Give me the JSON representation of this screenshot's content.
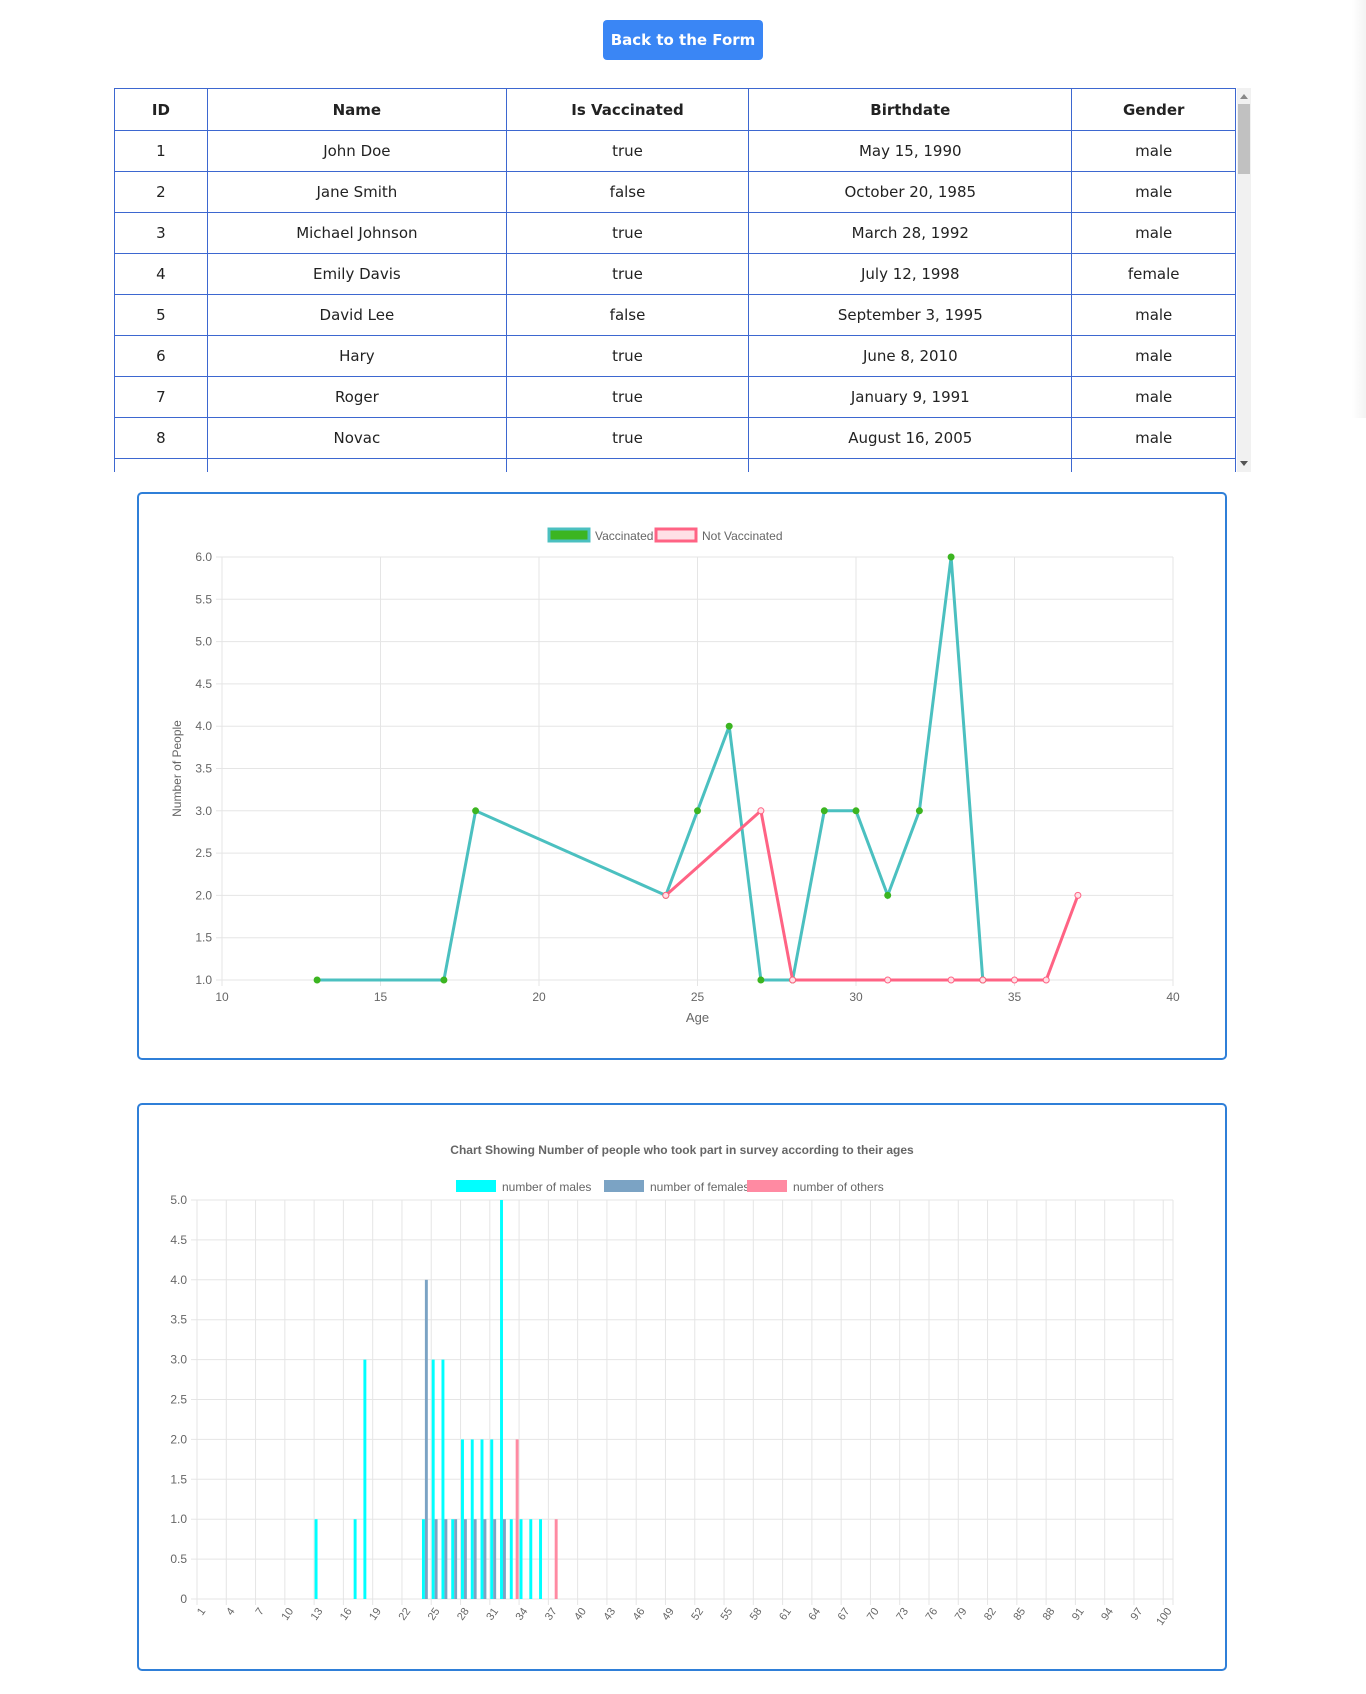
{
  "back_button": {
    "label": "Back to the Form"
  },
  "table": {
    "columns": [
      "ID",
      "Name",
      "Is Vaccinated",
      "Birthdate",
      "Gender"
    ],
    "rows": [
      [
        "1",
        "John Doe",
        "true",
        "May 15, 1990",
        "male"
      ],
      [
        "2",
        "Jane Smith",
        "false",
        "October 20, 1985",
        "male"
      ],
      [
        "3",
        "Michael Johnson",
        "true",
        "March 28, 1992",
        "male"
      ],
      [
        "4",
        "Emily Davis",
        "true",
        "July 12, 1998",
        "female"
      ],
      [
        "5",
        "David Lee",
        "false",
        "September 3, 1995",
        "male"
      ],
      [
        "6",
        "Hary",
        "true",
        "June 8, 2010",
        "male"
      ],
      [
        "7",
        "Roger",
        "true",
        "January 9, 1991",
        "male"
      ],
      [
        "8",
        "Novac",
        "true",
        "August 16, 2005",
        "male"
      ],
      [
        "",
        "",
        "",
        "",
        ""
      ]
    ]
  },
  "chart_data": [
    {
      "type": "line",
      "title": "",
      "xlabel": "Age",
      "ylabel": "Number of People",
      "xlim": [
        10,
        40
      ],
      "ylim": [
        1,
        6
      ],
      "x_ticks": [
        "10",
        "15",
        "20",
        "25",
        "30",
        "35",
        "40"
      ],
      "y_ticks": [
        "1.0",
        "1.5",
        "2.0",
        "2.5",
        "3.0",
        "3.5",
        "4.0",
        "4.5",
        "5.0",
        "5.5",
        "6.0"
      ],
      "grid": true,
      "legend": "top-center",
      "series": [
        {
          "name": "Vaccinated",
          "color": "#4bc0c0",
          "point_color": "#3cb521",
          "legend_fill": "#3cb521",
          "points": [
            [
              13,
              1
            ],
            [
              17,
              1
            ],
            [
              18,
              3
            ],
            [
              24,
              2
            ],
            [
              25,
              3
            ],
            [
              26,
              4
            ],
            [
              27,
              1
            ],
            [
              28,
              1
            ],
            [
              29,
              3
            ],
            [
              30,
              3
            ],
            [
              31,
              2
            ],
            [
              32,
              3
            ],
            [
              33,
              6
            ],
            [
              34,
              1
            ]
          ]
        },
        {
          "name": "Not Vaccinated",
          "color": "#ff6384",
          "point_color": "#ff6384",
          "legend_fill": "#ffe0e6",
          "points": [
            [
              24,
              2
            ],
            [
              27,
              3
            ],
            [
              28,
              1
            ],
            [
              31,
              1
            ],
            [
              33,
              1
            ],
            [
              34,
              1
            ],
            [
              35,
              1
            ],
            [
              36,
              1
            ],
            [
              37,
              2
            ]
          ]
        }
      ]
    },
    {
      "type": "bar",
      "title": "Chart Showing Number of people who took part in survey according to their ages",
      "xlabel": "",
      "ylabel": "",
      "ylim": [
        0,
        5
      ],
      "y_ticks": [
        "0",
        "0.5",
        "1.0",
        "1.5",
        "2.0",
        "2.5",
        "3.0",
        "3.5",
        "4.0",
        "4.5",
        "5.0"
      ],
      "x_tick_labels": [
        "1",
        "4",
        "7",
        "10",
        "13",
        "16",
        "19",
        "22",
        "25",
        "28",
        "31",
        "34",
        "37",
        "40",
        "43",
        "46",
        "49",
        "52",
        "55",
        "58",
        "61",
        "64",
        "67",
        "70",
        "73",
        "76",
        "79",
        "82",
        "85",
        "88",
        "91",
        "94",
        "97",
        "100"
      ],
      "grid": true,
      "legend": "top-center",
      "series": [
        {
          "name": "number of males",
          "color": "#00ffff",
          "points": [
            [
              13,
              1
            ],
            [
              17,
              1
            ],
            [
              18,
              3
            ],
            [
              24,
              1
            ],
            [
              25,
              3
            ],
            [
              26,
              3
            ],
            [
              27,
              1
            ],
            [
              28,
              2
            ],
            [
              29,
              2
            ],
            [
              30,
              2
            ],
            [
              31,
              2
            ],
            [
              32,
              5
            ],
            [
              33,
              1
            ],
            [
              34,
              1
            ],
            [
              35,
              1
            ],
            [
              36,
              1
            ]
          ]
        },
        {
          "name": "number of females",
          "color": "#7ba3c4",
          "points": [
            [
              24,
              4
            ],
            [
              25,
              1
            ],
            [
              26,
              1
            ],
            [
              27,
              1
            ],
            [
              28,
              1
            ],
            [
              29,
              1
            ],
            [
              30,
              1
            ],
            [
              31,
              1
            ],
            [
              32,
              1
            ]
          ]
        },
        {
          "name": "number of others",
          "color": "#ff8aa2",
          "points": [
            [
              33,
              2
            ],
            [
              37,
              1
            ]
          ]
        }
      ]
    }
  ]
}
